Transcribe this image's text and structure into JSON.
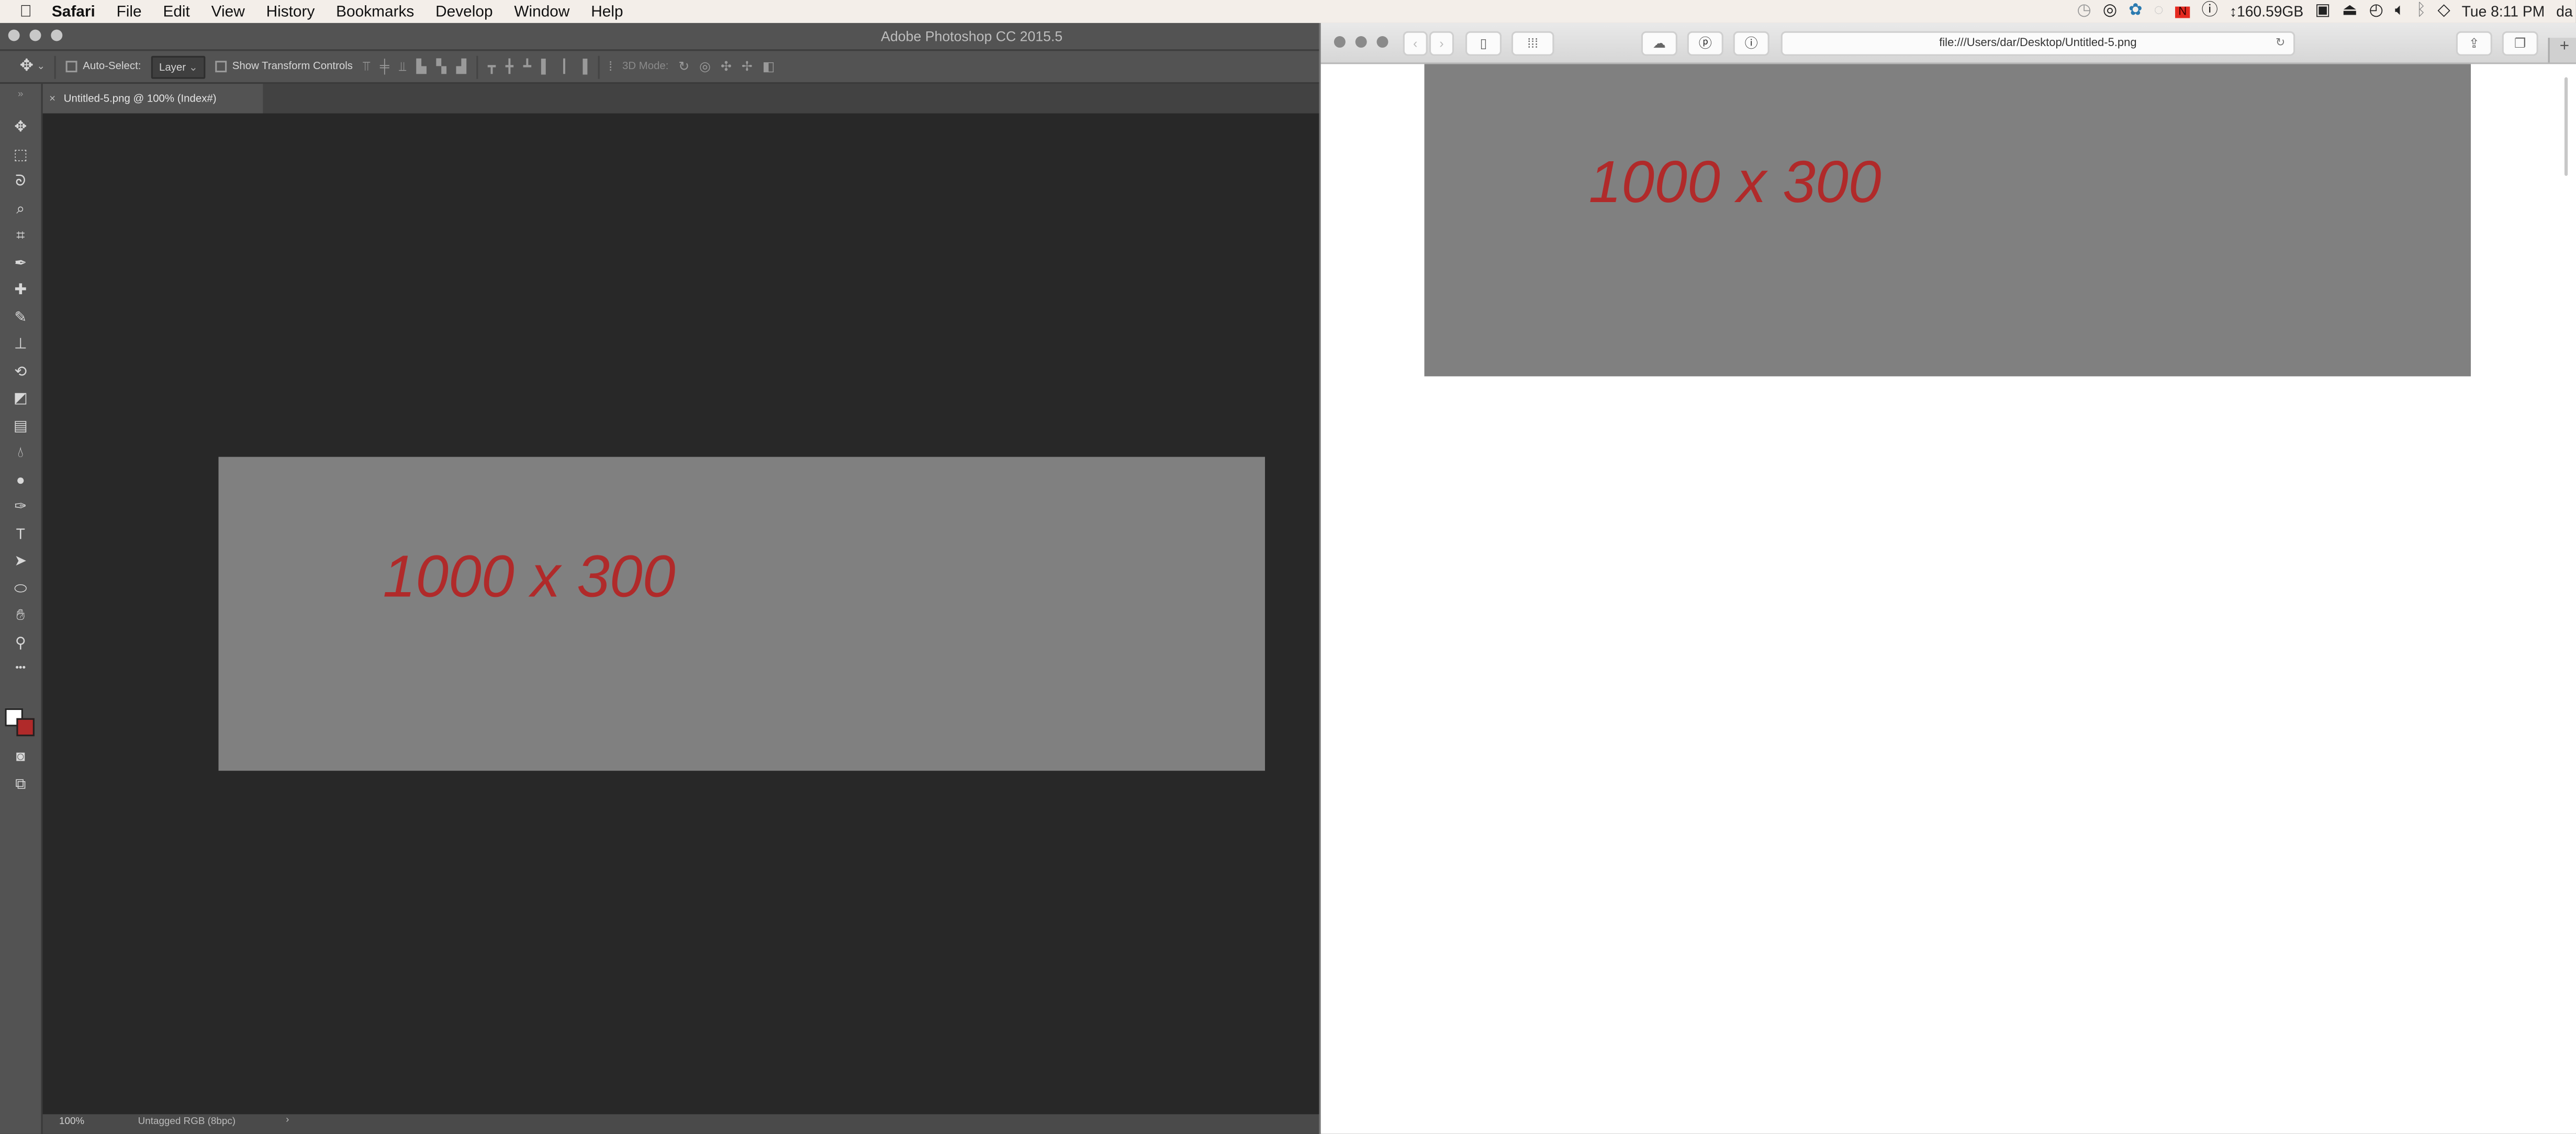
{
  "menubar": {
    "apple_icon": "apple-icon",
    "app": "Safari",
    "items": [
      "File",
      "Edit",
      "View",
      "History",
      "Bookmarks",
      "Develop",
      "Window",
      "Help"
    ],
    "status": {
      "icons": [
        "time-machine-icon",
        "creative-cloud-icon",
        "sync-icon",
        "disabled-app-icon",
        "red-app-icon",
        "info-icon"
      ],
      "disk": "↕160.59GB",
      "icons2": [
        "display-icon",
        "airplay-icon",
        "clock-icon",
        "volume-icon",
        "bluetooth-icon",
        "wifi-icon"
      ],
      "clock": "Tue 8:11 PM",
      "user": "da"
    }
  },
  "photoshop": {
    "title": "Adobe Photoshop CC 2015.5",
    "options": {
      "auto_select_label": "Auto-Select:",
      "auto_select_value": "Layer",
      "auto_select_checked": false,
      "show_transform_label": "Show Transform Controls",
      "show_transform_checked": false,
      "mode_3d_label": "3D Mode:"
    },
    "tab": {
      "close": "×",
      "title": "Untitled-5.png @ 100% (Index#)"
    },
    "tools": [
      "move",
      "marquee",
      "lasso",
      "quick-select",
      "crop",
      "eyedropper",
      "healing",
      "brush",
      "stamp",
      "history-brush",
      "eraser",
      "gradient",
      "blur",
      "dodge",
      "pen",
      "type",
      "path-select",
      "ellipse",
      "hand",
      "zoom",
      "more"
    ],
    "colors": {
      "foreground": "#ffffff",
      "background": "#b02a2a"
    },
    "doc_text": "1000 x 300",
    "status": {
      "zoom": "100%",
      "profile": "Untagged RGB (8bpc)",
      "arrow": "›"
    }
  },
  "safari": {
    "url": "file:///Users/dar/Desktop/Untitled-5.png",
    "doc_text": "1000 x 300",
    "new_tab": "+"
  },
  "colors": {
    "doc_gray": "#808080",
    "doc_text_red": "#b02a2a",
    "ps_chrome": "#535353",
    "ps_canvas": "#282828"
  }
}
